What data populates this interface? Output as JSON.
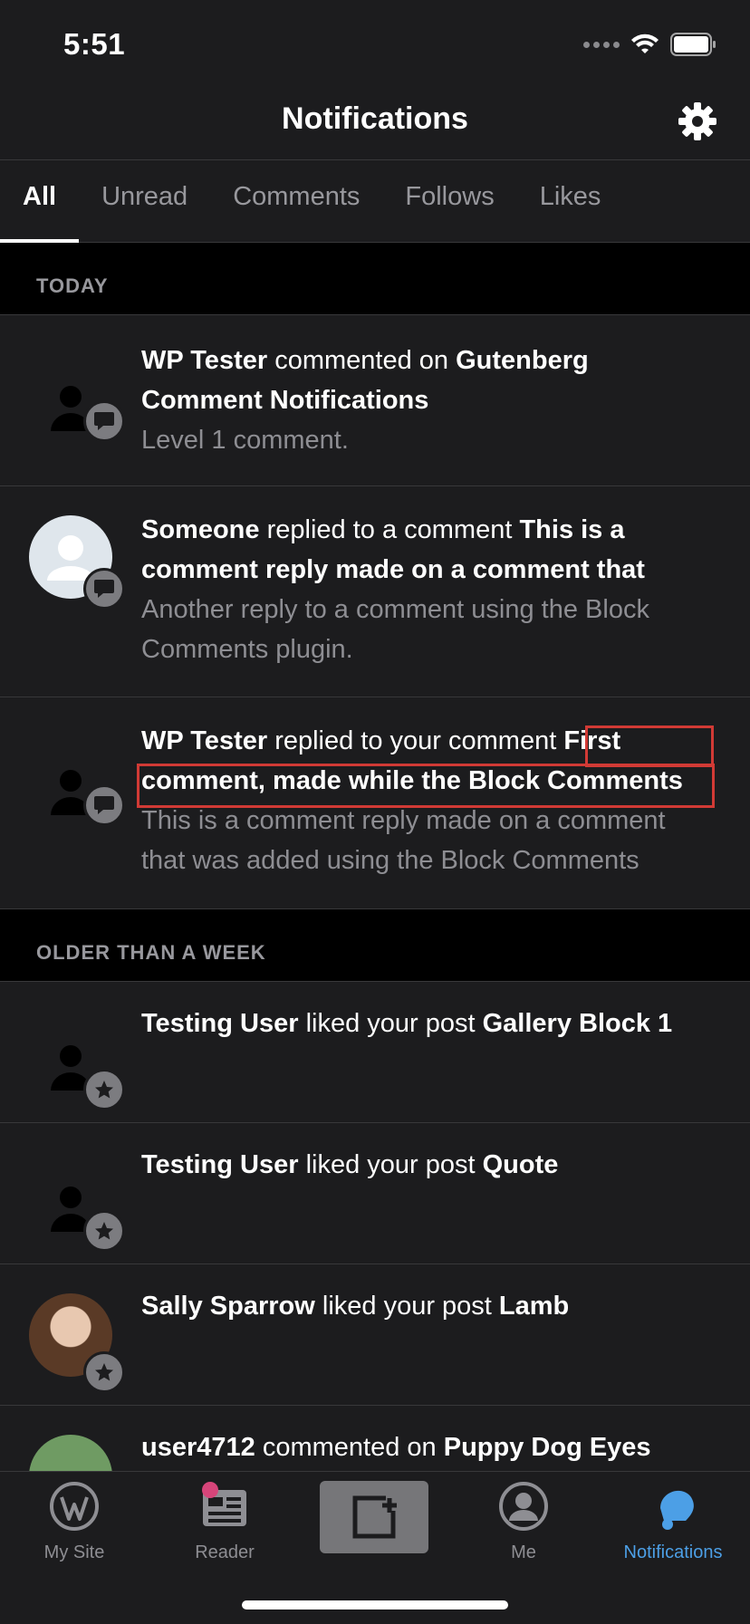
{
  "status_bar": {
    "time": "5:51"
  },
  "header": {
    "title": "Notifications",
    "settings_icon": "gear-icon"
  },
  "tabs": [
    {
      "label": "All",
      "active": true
    },
    {
      "label": "Unread",
      "active": false
    },
    {
      "label": "Comments",
      "active": false
    },
    {
      "label": "Follows",
      "active": false
    },
    {
      "label": "Likes",
      "active": false
    }
  ],
  "sections": {
    "today": "TODAY",
    "older": "OLDER THAN A WEEK"
  },
  "notifications": [
    {
      "actor": "WP Tester",
      "action": " commented on ",
      "target": "Gutenberg Comment Notifications",
      "snippet": "Level 1 comment.",
      "badge_icon": "comment-icon",
      "avatar": "blank"
    },
    {
      "actor": "Someone",
      "action": " replied to a comment ",
      "target": "This is a comment reply made on a comment that",
      "snippet": "Another reply to a comment using the Block Comments plugin.",
      "badge_icon": "comment-icon",
      "avatar": "generic"
    },
    {
      "actor": "WP Tester",
      "action": " replied to your comment ",
      "target": "First comment, made while the Block Comments",
      "snippet": "This is a comment reply made on a comment that was added using the Block Comments",
      "badge_icon": "comment-icon",
      "avatar": "blank"
    },
    {
      "actor": "Testing User",
      "action": " liked your post ",
      "target": "Gallery Block 1",
      "badge_icon": "star-icon",
      "avatar": "blank"
    },
    {
      "actor": "Testing User",
      "action": " liked your post ",
      "target": "Quote",
      "badge_icon": "star-icon",
      "avatar": "blank"
    },
    {
      "actor": "Sally Sparrow",
      "action": " liked your post ",
      "target": "Lamb",
      "badge_icon": "star-icon",
      "avatar": "photo"
    },
    {
      "actor": "user4712",
      "action": " commented on ",
      "target": "Puppy Dog Eyes",
      "avatar": "photo"
    }
  ],
  "tab_bar": [
    {
      "label": "My Site",
      "icon": "wordpress-icon",
      "active": false
    },
    {
      "label": "Reader",
      "icon": "reader-icon",
      "active": false
    },
    {
      "label": "",
      "icon": "create-post-icon",
      "active": false
    },
    {
      "label": "Me",
      "icon": "profile-icon",
      "active": false
    },
    {
      "label": "Notifications",
      "icon": "bell-icon",
      "active": true
    }
  ],
  "colors": {
    "accent": "#4c9fe6",
    "highlight": "#d13a35",
    "background": "#1c1c1e",
    "section_bg": "#000000"
  }
}
